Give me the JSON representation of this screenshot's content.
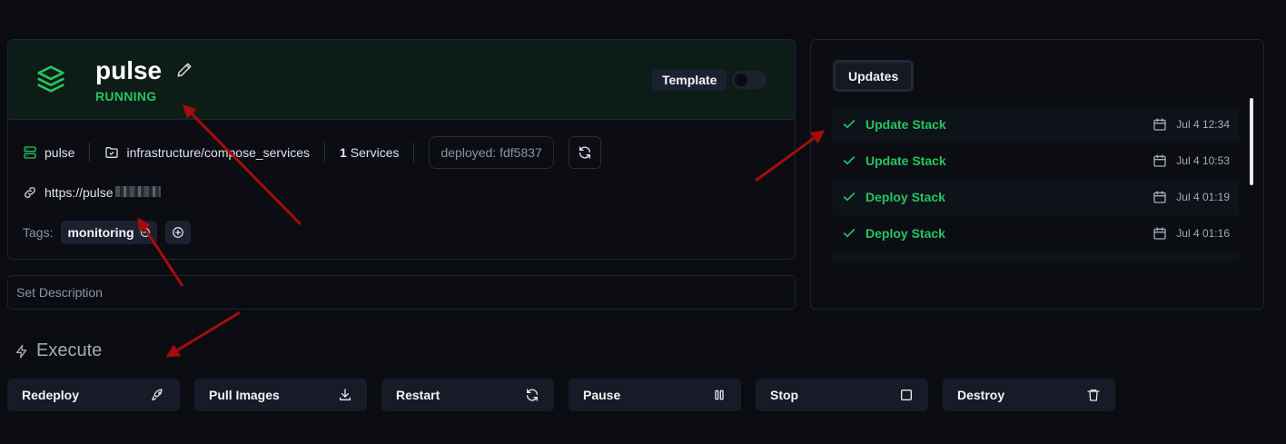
{
  "stack": {
    "name": "pulse",
    "status": "RUNNING",
    "template_label": "Template",
    "template_enabled": false,
    "server": "pulse",
    "path": "infrastructure/compose_services",
    "services_count": "1",
    "services_label": "Services",
    "deployed": "deployed: fdf5837",
    "url": "https://pulse",
    "tags_label": "Tags:",
    "tags": [
      "monitoring"
    ]
  },
  "description": {
    "placeholder": "Set Description"
  },
  "execute": {
    "title": "Execute",
    "actions": [
      {
        "label": "Redeploy",
        "icon": "rocket-icon"
      },
      {
        "label": "Pull Images",
        "icon": "download-icon"
      },
      {
        "label": "Restart",
        "icon": "refresh-icon"
      },
      {
        "label": "Pause",
        "icon": "pause-icon"
      },
      {
        "label": "Stop",
        "icon": "stop-icon"
      },
      {
        "label": "Destroy",
        "icon": "trash-icon"
      }
    ]
  },
  "updates": {
    "tab_label": "Updates",
    "items": [
      {
        "label": "Update Stack",
        "time": "Jul 4 12:34"
      },
      {
        "label": "Update Stack",
        "time": "Jul 4 10:53"
      },
      {
        "label": "Deploy Stack",
        "time": "Jul 4 01:19"
      },
      {
        "label": "Deploy Stack",
        "time": "Jul 4 01:16"
      }
    ]
  },
  "colors": {
    "accent_green": "#22c55e",
    "background": "#0a0c12",
    "header_bg": "#0d1c17",
    "annotation_arrow": "#a30d0d"
  }
}
